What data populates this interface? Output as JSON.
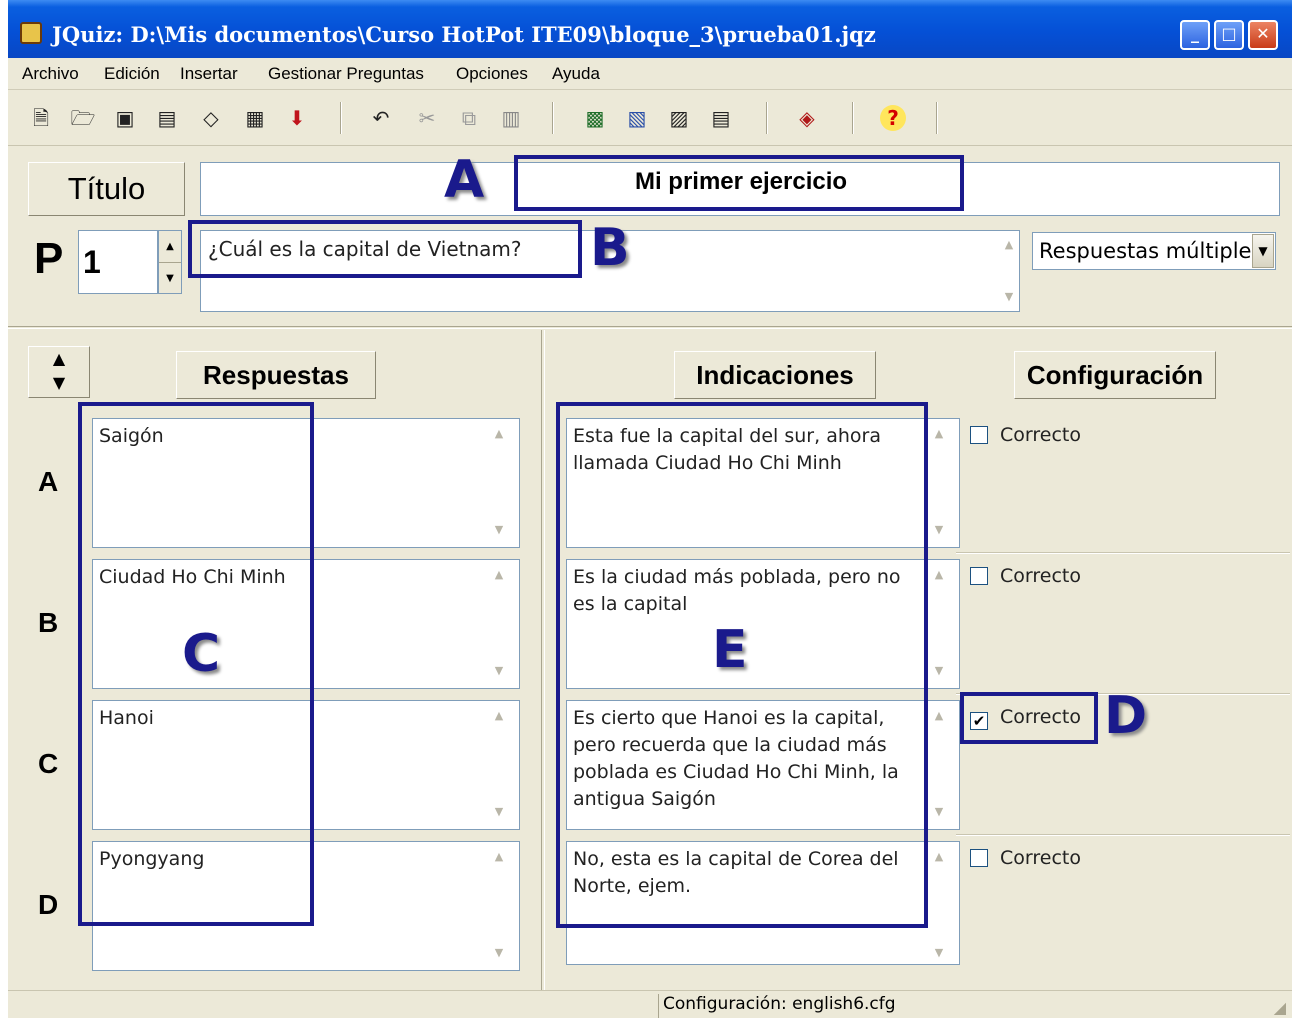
{
  "window": {
    "title": "JQuiz: D:\\Mis documentos\\Curso HotPot ITE09\\bloque_3\\prueba01.jqz",
    "icon": "jquiz-app-icon",
    "controls": {
      "minimize": "_",
      "maximize": "□",
      "close": "✕"
    }
  },
  "menu": [
    "Archivo",
    "Edición",
    "Insertar",
    "Gestionar Preguntas",
    "Opciones",
    "Ayuda"
  ],
  "toolbar": {
    "icons": [
      "new-file-icon",
      "open-folder-icon",
      "save-icon",
      "save-as-icon",
      "eraser-icon",
      "web-page-icon",
      "down-arrow-icon",
      "undo-icon",
      "cut-icon",
      "copy-icon",
      "paste-icon",
      "export-html-icon",
      "export-drag-icon",
      "export-web-icon",
      "export-print-icon",
      "config-icon",
      "help-icon"
    ],
    "glyphs": [
      "🗎",
      "🗁",
      "▣",
      "▤",
      "◇",
      "▦",
      "⬇",
      "↶",
      "✂",
      "⧉",
      "▥",
      "▩",
      "▧",
      "▨",
      "▤",
      "◈",
      "?"
    ]
  },
  "header": {
    "titulo_label": "Título",
    "titulo_value": "Mi primer ejercicio",
    "p_label": "P",
    "question_number": "1",
    "question_text": "¿Cuál es la capital de Vietnam?",
    "question_type": "Respuestas múltiples"
  },
  "columns": {
    "answers": "Respuestas",
    "hints": "Indicaciones",
    "config": "Configuración"
  },
  "rows": [
    {
      "letter": "A",
      "answer": "Saigón",
      "hint": "Esta fue la capital del sur, ahora llamada Ciudad Ho Chi Minh",
      "correct_label": "Correcto",
      "correct": false
    },
    {
      "letter": "B",
      "answer": "Ciudad Ho Chi Minh",
      "hint": "Es la ciudad más poblada, pero no es la capital",
      "correct_label": "Correcto",
      "correct": false
    },
    {
      "letter": "C",
      "answer": "Hanoi",
      "hint": "Es cierto que Hanoi es la capital, pero recuerda que la ciudad más poblada es Ciudad Ho Chi Minh, la antigua Saigón",
      "correct_label": "Correcto",
      "correct": true
    },
    {
      "letter": "D",
      "answer": "Pyongyang",
      "hint": "No, esta es la capital de Corea del Norte, ejem.",
      "correct_label": "Correcto",
      "correct": false
    }
  ],
  "annotations": {
    "a": "A",
    "b": "B",
    "c": "C",
    "d": "D",
    "e": "E",
    "color": "#1a1a8c"
  },
  "status": "Configuración: english6.cfg"
}
